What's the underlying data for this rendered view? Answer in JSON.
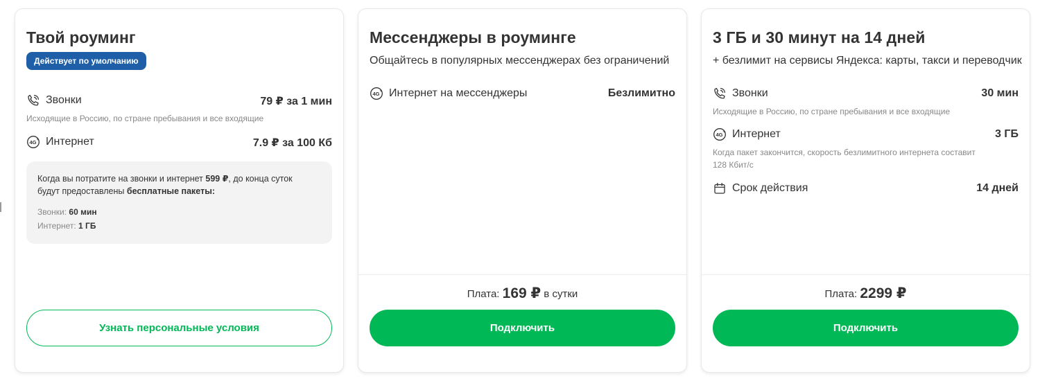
{
  "cards": [
    {
      "title": "Твой роуминг",
      "badge": "Действует по умолчанию",
      "features": [
        {
          "icon": "phone-icon",
          "label": "Звонки",
          "value": "79 ₽ за 1 мин",
          "desc": "Исходящие в Россию, по стране пребывания и все входящие"
        },
        {
          "icon": "4g-plus-icon",
          "label": "Интернет",
          "value": "7.9 ₽ за 100 Кб"
        }
      ],
      "info": {
        "text_part1": "Когда вы потратите на звонки и интернет ",
        "text_bold1": "599 ₽",
        "text_part2": ", до конца суток будут предоставлены ",
        "text_bold2": "бесплатные пакеты:",
        "calls_label": "Звонки: ",
        "calls_value": "60 мин",
        "internet_label": "Интернет: ",
        "internet_value": "1 ГБ"
      },
      "button": "Узнать персональные условия"
    },
    {
      "title": "Мессенджеры в роуминге",
      "subtitle": "Общайтесь в популярных мессенджерах без ограничений",
      "features": [
        {
          "icon": "4g-plus-icon",
          "label": "Интернет на мессенджеры",
          "value": "Безлимитно"
        }
      ],
      "price_prefix": "Плата: ",
      "price_amount": "169 ₽",
      "price_suffix": " в сутки",
      "button": "Подключить"
    },
    {
      "title": "3 ГБ и 30 минут на 14 дней",
      "subtitle": "+ безлимит на сервисы Яндекса: карты, такси и переводчик",
      "features": [
        {
          "icon": "phone-icon",
          "label": "Звонки",
          "value": "30 мин",
          "desc": "Исходящие в Россию, по стране пребывания и все входящие"
        },
        {
          "icon": "4g-plus-icon",
          "label": "Интернет",
          "value": "3 ГБ",
          "desc": "Когда пакет закончится, скорость безлимитного интернета составит 128 Кбит/с"
        },
        {
          "icon": "calendar-icon",
          "label": "Срок действия",
          "value": "14 дней"
        }
      ],
      "price_prefix": "Плата: ",
      "price_amount": "2299 ₽",
      "button": "Подключить"
    }
  ],
  "colors": {
    "brand_green": "#00b956",
    "badge_blue": "#1e5fa8",
    "text_primary": "#333333",
    "text_secondary": "#888888",
    "info_bg": "#f3f3f4"
  }
}
